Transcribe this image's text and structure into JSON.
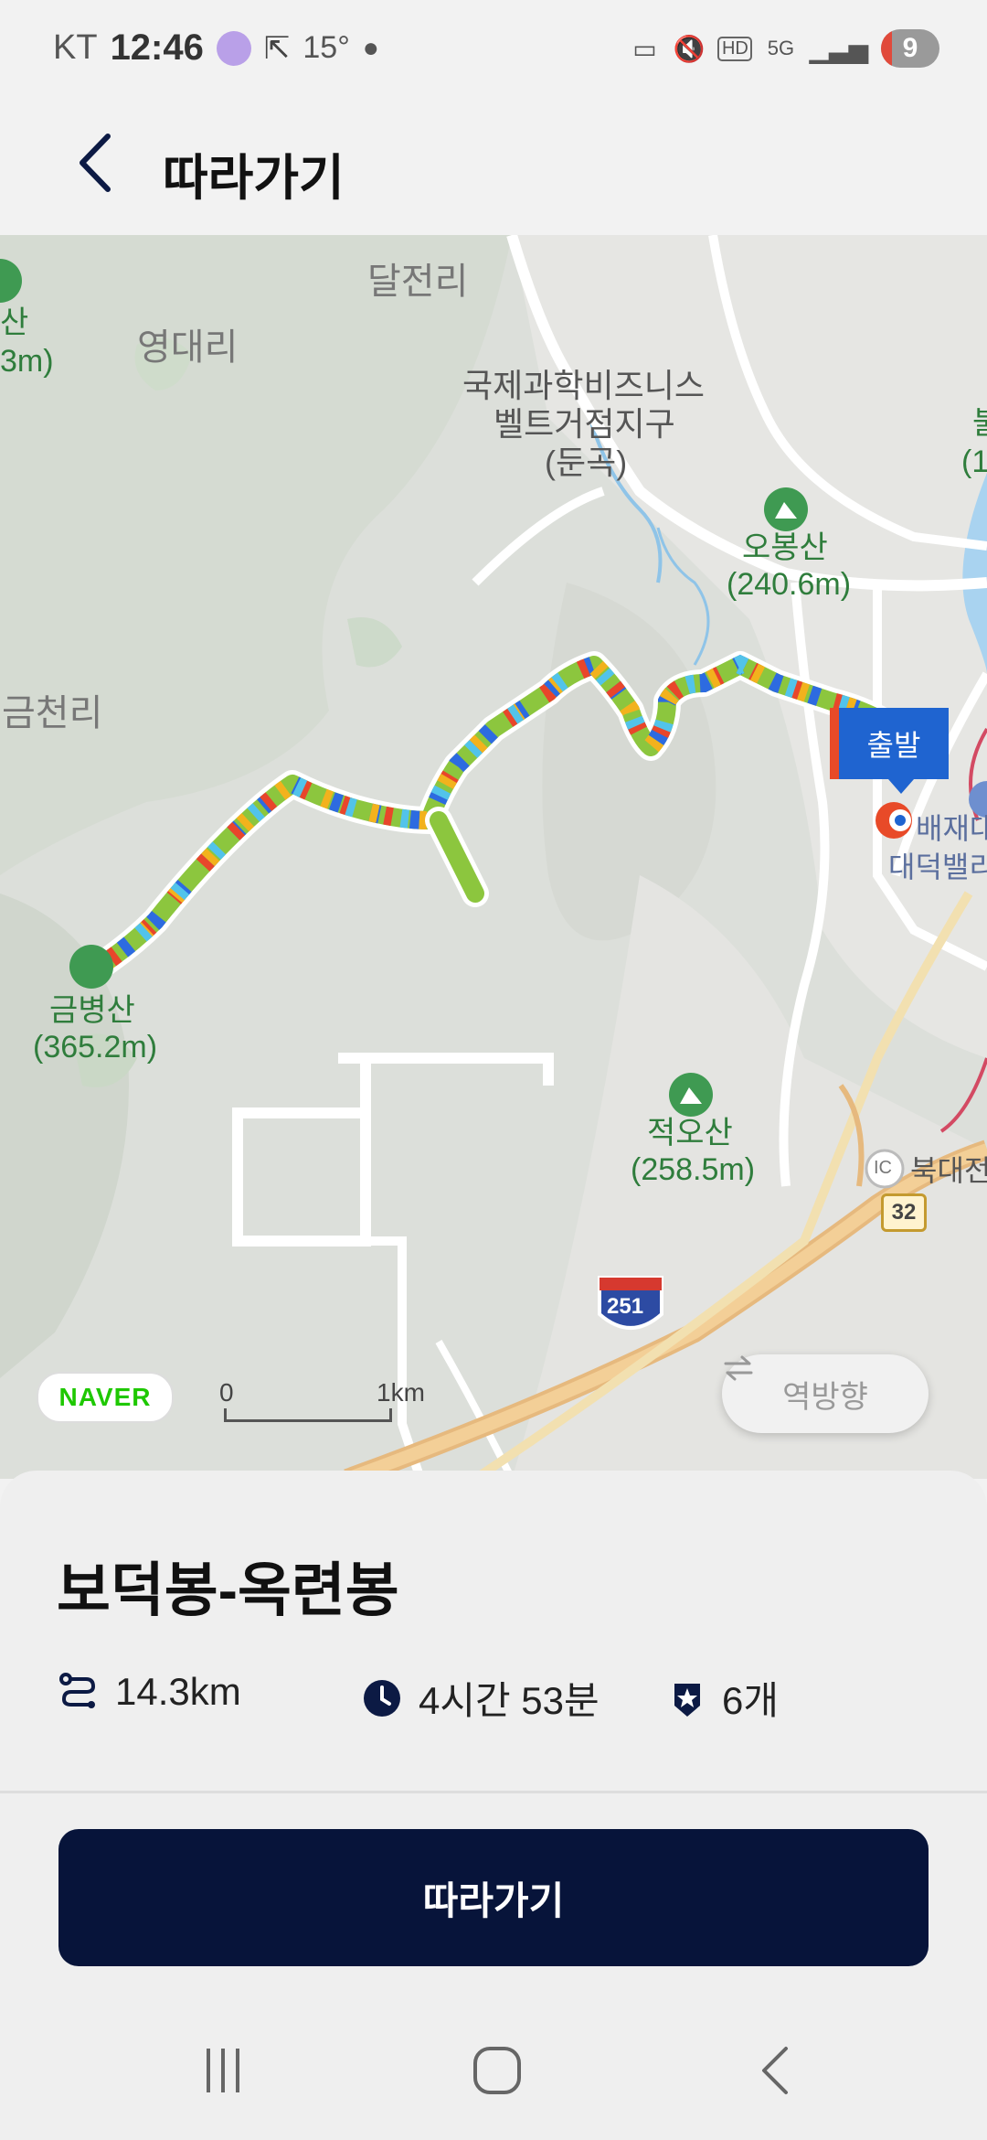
{
  "status_bar": {
    "carrier": "KT",
    "time": "12:46",
    "temperature": "15°",
    "battery": "9",
    "icons": [
      "cast-icon",
      "mute-icon",
      "hd-icon",
      "5g-icon",
      "signal-icon",
      "battery-icon"
    ]
  },
  "header": {
    "title": "따라가기",
    "back_icon": "chevron-left-icon"
  },
  "map": {
    "places": {
      "daljeon": "달전리",
      "yeongdae": "영대리",
      "geumcheon": "금천리",
      "belt_line1": "국제과학비즈니스",
      "belt_line2": "벨트거점지구",
      "belt_line3": "(둔곡)",
      "left_peak_partial1": "산",
      "left_peak_partial2": "3m)",
      "right_partial1": "불",
      "right_partial2": "(1"
    },
    "peaks": {
      "obong_name": "오봉산",
      "obong_elev": "(240.6m)",
      "geumbyeong_name": "금병산",
      "geumbyeong_elev": "(365.2m)",
      "jeogo_name": "적오산",
      "jeogo_elev": "(258.5m)"
    },
    "pois": {
      "baejae1": "배재대",
      "baejae2": "대덕밸리",
      "bukdaejeon": "북대전",
      "ic": "IC"
    },
    "road_numbers": {
      "route32": "32",
      "route251": "251"
    },
    "start_label": "출발",
    "logo": "NAVER",
    "scale": {
      "zero": "0",
      "one": "1km"
    },
    "reverse_label": "역방향",
    "reverse_icon": "swap-arrows-icon"
  },
  "course": {
    "title": "보덕봉-옥련봉",
    "distance": "14.3km",
    "duration": "4시간 53분",
    "checkpoints": "6개",
    "icons": [
      "route-icon",
      "clock-icon",
      "badge-star-icon"
    ]
  },
  "cta": {
    "follow_label": "따라가기"
  },
  "colors": {
    "primary_navy": "#07143a",
    "start_blue": "#1f64d0",
    "route_green": "#8cc63e",
    "peak_green": "#2f7d3c"
  }
}
